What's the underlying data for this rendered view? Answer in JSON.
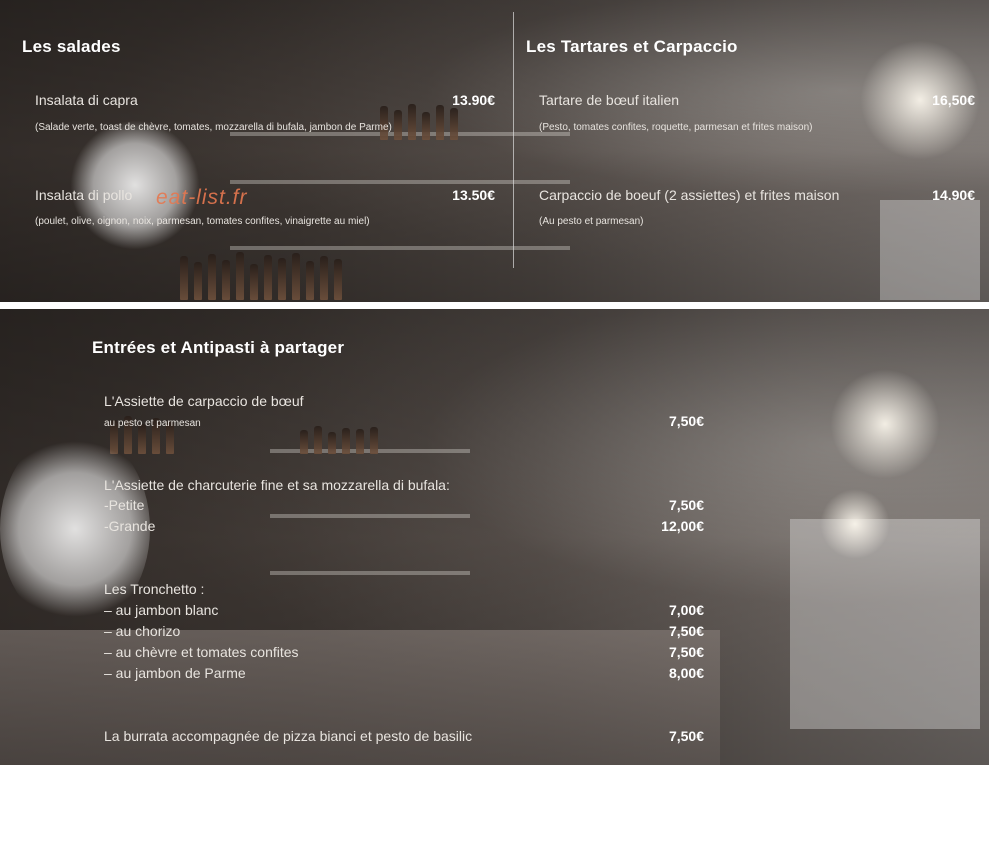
{
  "watermark": "eat-list.fr",
  "salades": {
    "title": "Les salades",
    "items": [
      {
        "name": "Insalata di capra",
        "price": "13.90€",
        "desc": "(Salade verte, toast de chèvre, tomates, mozzarella di bufala, jambon de Parme)"
      },
      {
        "name": "Insalata di pollo",
        "price": "13.50€",
        "desc": "(poulet, olive, oignon, noix, parmesan, tomates confites, vinaigrette au miel)"
      }
    ]
  },
  "tartares": {
    "title": "Les Tartares et Carpaccio",
    "items": [
      {
        "name": "Tartare de bœuf italien",
        "price": "16,50€",
        "desc": "(Pesto, tomates confites, roquette, parmesan et frites maison)"
      },
      {
        "name": "Carpaccio de boeuf (2 assiettes) et frites maison",
        "price": "14.90€",
        "desc": "(Au pesto et parmesan)"
      }
    ]
  },
  "entrees": {
    "title": "Entrées et Antipasti à partager",
    "carpaccio": {
      "name": "L'Assiette de carpaccio de bœuf",
      "desc": "au pesto et parmesan",
      "price": "7,50€"
    },
    "charcuterie": {
      "name": "L'Assiette de charcuterie fine et sa mozzarella di bufala:",
      "options": [
        {
          "label": "-Petite",
          "price": "7,50€"
        },
        {
          "label": "-Grande",
          "price": "12,00€"
        }
      ]
    },
    "tronchetto": {
      "name": "Les Tronchetto :",
      "options": [
        {
          "label": "– au jambon blanc",
          "price": "7,00€"
        },
        {
          "label": "– au chorizo",
          "price": "7,50€"
        },
        {
          "label": "– au chèvre et tomates confites",
          "price": "7,50€"
        },
        {
          "label": "– au jambon de Parme",
          "price": "8,00€"
        }
      ]
    },
    "burrata": {
      "name": "La burrata accompagnée de pizza bianci et pesto de basilic",
      "price": "7,50€"
    }
  }
}
